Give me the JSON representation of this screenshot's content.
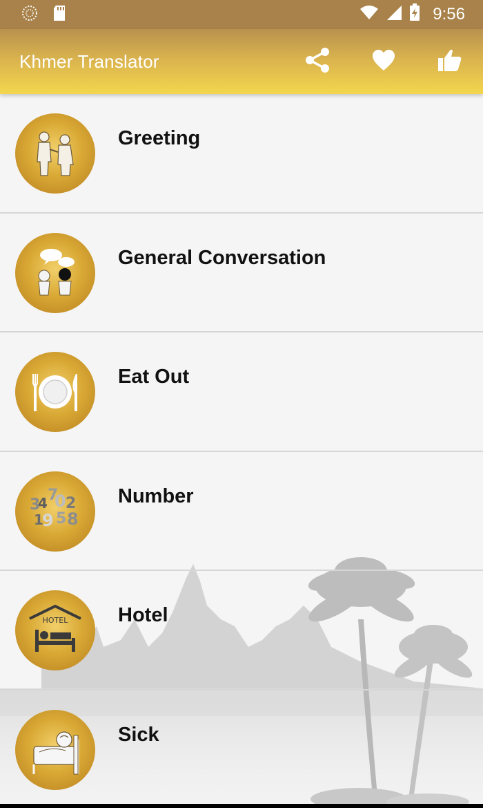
{
  "status_bar": {
    "time": "9:56",
    "left_icons": [
      "loading-circle-icon",
      "sd-card-icon"
    ],
    "right_icons": [
      "wifi-icon",
      "cell-signal-icon",
      "battery-charging-icon"
    ]
  },
  "app_bar": {
    "title": "Khmer Translator",
    "actions": [
      "share-icon",
      "heart-icon",
      "thumbs-up-icon"
    ]
  },
  "categories": [
    {
      "label": "Greeting",
      "icon": "greeting-people-icon"
    },
    {
      "label": "General Conversation",
      "icon": "conversation-bubbles-icon"
    },
    {
      "label": "Eat Out",
      "icon": "plate-fork-knife-icon"
    },
    {
      "label": "Number",
      "icon": "numbers-icon"
    },
    {
      "label": "Hotel",
      "icon": "hotel-bed-icon"
    },
    {
      "label": "Sick",
      "icon": "sick-bed-icon"
    }
  ],
  "hotel_icon_text": "HOTEL",
  "number_icon_text": [
    "3",
    "4",
    "7",
    "0",
    "2",
    "1",
    "9",
    "5",
    "8"
  ],
  "colors": {
    "status_bar": "#a8824a",
    "app_bar_top": "#b8924e",
    "app_bar_bottom": "#f3d64d",
    "icon_gold": "#d9a935",
    "list_background": "#f5f5f5",
    "divider": "#d6d6d6"
  }
}
